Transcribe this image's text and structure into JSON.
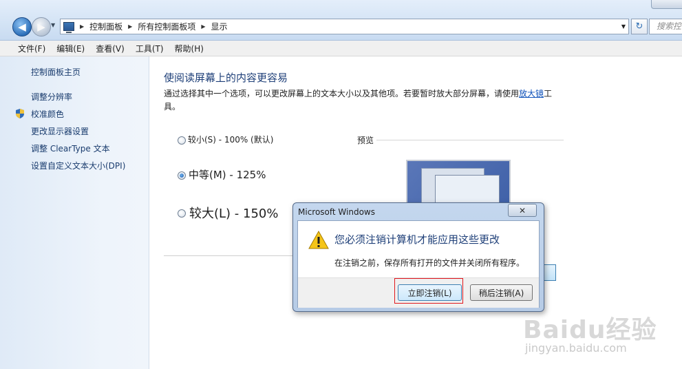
{
  "address_bar": {
    "breadcrumbs": [
      "控制面板",
      "所有控制面板项",
      "显示"
    ],
    "search_placeholder": "搜索控"
  },
  "menu": [
    "文件(F)",
    "编辑(E)",
    "查看(V)",
    "工具(T)",
    "帮助(H)"
  ],
  "sidebar": {
    "home": "控制面板主页",
    "links": [
      "调整分辨率",
      "校准颜色",
      "更改显示器设置",
      "调整 ClearType 文本",
      "设置自定义文本大小(DPI)"
    ]
  },
  "main": {
    "heading": "使阅读屏幕上的内容更容易",
    "description": "通过选择其中一个选项，可以更改屏幕上的文本大小以及其他项。若要暂时放大部分屏幕，请使用",
    "magnifier_link": "放大镜",
    "description_end": "工具。",
    "options": [
      {
        "label": "较小(S) - 100% (默认)",
        "selected": false
      },
      {
        "label": "中等(M) - 125%",
        "selected": true
      },
      {
        "label": "较大(L) - 150%",
        "selected": false
      }
    ],
    "preview_label": "预览"
  },
  "dialog": {
    "title": "Microsoft Windows",
    "main_instruction": "您必须注销计算机才能应用这些更改",
    "content": "在注销之前，保存所有打开的文件并关闭所有程序。",
    "button_now": "立即注销(L)",
    "button_later": "稍后注销(A)"
  },
  "watermark": {
    "top": "Baidu经验",
    "bottom": "jingyan.baidu.com"
  }
}
